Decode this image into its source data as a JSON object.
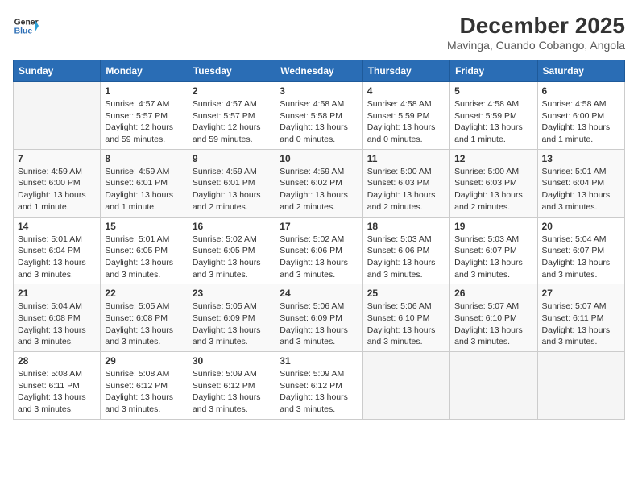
{
  "header": {
    "logo_line1": "General",
    "logo_line2": "Blue",
    "title": "December 2025",
    "subtitle": "Mavinga, Cuando Cobango, Angola"
  },
  "days_of_week": [
    "Sunday",
    "Monday",
    "Tuesday",
    "Wednesday",
    "Thursday",
    "Friday",
    "Saturday"
  ],
  "weeks": [
    [
      {
        "day": "",
        "info": ""
      },
      {
        "day": "1",
        "info": "Sunrise: 4:57 AM\nSunset: 5:57 PM\nDaylight: 12 hours\nand 59 minutes."
      },
      {
        "day": "2",
        "info": "Sunrise: 4:57 AM\nSunset: 5:57 PM\nDaylight: 12 hours\nand 59 minutes."
      },
      {
        "day": "3",
        "info": "Sunrise: 4:58 AM\nSunset: 5:58 PM\nDaylight: 13 hours\nand 0 minutes."
      },
      {
        "day": "4",
        "info": "Sunrise: 4:58 AM\nSunset: 5:59 PM\nDaylight: 13 hours\nand 0 minutes."
      },
      {
        "day": "5",
        "info": "Sunrise: 4:58 AM\nSunset: 5:59 PM\nDaylight: 13 hours\nand 1 minute."
      },
      {
        "day": "6",
        "info": "Sunrise: 4:58 AM\nSunset: 6:00 PM\nDaylight: 13 hours\nand 1 minute."
      }
    ],
    [
      {
        "day": "7",
        "info": "Sunrise: 4:59 AM\nSunset: 6:00 PM\nDaylight: 13 hours\nand 1 minute."
      },
      {
        "day": "8",
        "info": "Sunrise: 4:59 AM\nSunset: 6:01 PM\nDaylight: 13 hours\nand 1 minute."
      },
      {
        "day": "9",
        "info": "Sunrise: 4:59 AM\nSunset: 6:01 PM\nDaylight: 13 hours\nand 2 minutes."
      },
      {
        "day": "10",
        "info": "Sunrise: 4:59 AM\nSunset: 6:02 PM\nDaylight: 13 hours\nand 2 minutes."
      },
      {
        "day": "11",
        "info": "Sunrise: 5:00 AM\nSunset: 6:03 PM\nDaylight: 13 hours\nand 2 minutes."
      },
      {
        "day": "12",
        "info": "Sunrise: 5:00 AM\nSunset: 6:03 PM\nDaylight: 13 hours\nand 2 minutes."
      },
      {
        "day": "13",
        "info": "Sunrise: 5:01 AM\nSunset: 6:04 PM\nDaylight: 13 hours\nand 3 minutes."
      }
    ],
    [
      {
        "day": "14",
        "info": "Sunrise: 5:01 AM\nSunset: 6:04 PM\nDaylight: 13 hours\nand 3 minutes."
      },
      {
        "day": "15",
        "info": "Sunrise: 5:01 AM\nSunset: 6:05 PM\nDaylight: 13 hours\nand 3 minutes."
      },
      {
        "day": "16",
        "info": "Sunrise: 5:02 AM\nSunset: 6:05 PM\nDaylight: 13 hours\nand 3 minutes."
      },
      {
        "day": "17",
        "info": "Sunrise: 5:02 AM\nSunset: 6:06 PM\nDaylight: 13 hours\nand 3 minutes."
      },
      {
        "day": "18",
        "info": "Sunrise: 5:03 AM\nSunset: 6:06 PM\nDaylight: 13 hours\nand 3 minutes."
      },
      {
        "day": "19",
        "info": "Sunrise: 5:03 AM\nSunset: 6:07 PM\nDaylight: 13 hours\nand 3 minutes."
      },
      {
        "day": "20",
        "info": "Sunrise: 5:04 AM\nSunset: 6:07 PM\nDaylight: 13 hours\nand 3 minutes."
      }
    ],
    [
      {
        "day": "21",
        "info": "Sunrise: 5:04 AM\nSunset: 6:08 PM\nDaylight: 13 hours\nand 3 minutes."
      },
      {
        "day": "22",
        "info": "Sunrise: 5:05 AM\nSunset: 6:08 PM\nDaylight: 13 hours\nand 3 minutes."
      },
      {
        "day": "23",
        "info": "Sunrise: 5:05 AM\nSunset: 6:09 PM\nDaylight: 13 hours\nand 3 minutes."
      },
      {
        "day": "24",
        "info": "Sunrise: 5:06 AM\nSunset: 6:09 PM\nDaylight: 13 hours\nand 3 minutes."
      },
      {
        "day": "25",
        "info": "Sunrise: 5:06 AM\nSunset: 6:10 PM\nDaylight: 13 hours\nand 3 minutes."
      },
      {
        "day": "26",
        "info": "Sunrise: 5:07 AM\nSunset: 6:10 PM\nDaylight: 13 hours\nand 3 minutes."
      },
      {
        "day": "27",
        "info": "Sunrise: 5:07 AM\nSunset: 6:11 PM\nDaylight: 13 hours\nand 3 minutes."
      }
    ],
    [
      {
        "day": "28",
        "info": "Sunrise: 5:08 AM\nSunset: 6:11 PM\nDaylight: 13 hours\nand 3 minutes."
      },
      {
        "day": "29",
        "info": "Sunrise: 5:08 AM\nSunset: 6:12 PM\nDaylight: 13 hours\nand 3 minutes."
      },
      {
        "day": "30",
        "info": "Sunrise: 5:09 AM\nSunset: 6:12 PM\nDaylight: 13 hours\nand 3 minutes."
      },
      {
        "day": "31",
        "info": "Sunrise: 5:09 AM\nSunset: 6:12 PM\nDaylight: 13 hours\nand 3 minutes."
      },
      {
        "day": "",
        "info": ""
      },
      {
        "day": "",
        "info": ""
      },
      {
        "day": "",
        "info": ""
      }
    ]
  ]
}
